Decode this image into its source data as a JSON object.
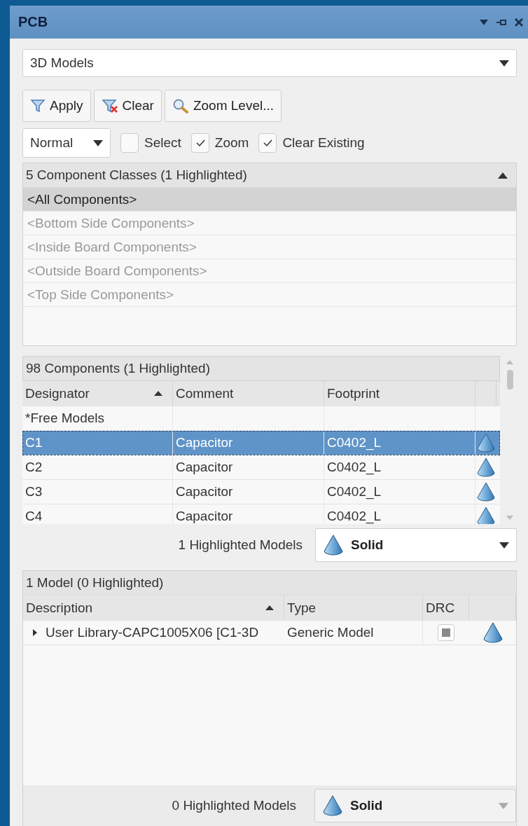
{
  "window": {
    "title": "PCB"
  },
  "mode_dropdown": {
    "value": "3D Models"
  },
  "buttons": [
    {
      "label": "Apply",
      "kind": "apply"
    },
    {
      "label": "Clear",
      "kind": "clear"
    },
    {
      "label": "Zoom Level...",
      "kind": "zoom"
    }
  ],
  "mask_dropdown": {
    "value": "Normal"
  },
  "options": [
    {
      "label": "Select",
      "checked": false
    },
    {
      "label": "Zoom",
      "checked": true
    },
    {
      "label": "Clear Existing",
      "checked": true
    }
  ],
  "classes": {
    "header": "5 Component Classes (1 Highlighted)",
    "expanded": true,
    "items": [
      {
        "label": "<All Components>",
        "selected": true
      },
      {
        "label": "<Bottom Side Components>",
        "selected": false
      },
      {
        "label": "<Inside Board Components>",
        "selected": false
      },
      {
        "label": "<Outside Board Components>",
        "selected": false
      },
      {
        "label": "<Top Side Components>",
        "selected": false
      }
    ]
  },
  "components": {
    "header": "98 Components (1 Highlighted)",
    "columns": [
      {
        "label": "Designator",
        "sorted": true
      },
      {
        "label": "Comment",
        "sorted": false
      },
      {
        "label": "Footprint",
        "sorted": false
      }
    ],
    "rows": [
      {
        "designator": "*Free Models",
        "comment": "",
        "footprint": "",
        "selected": false,
        "has_model": false
      },
      {
        "designator": "C1",
        "comment": "Capacitor",
        "footprint": "C0402_L",
        "selected": true,
        "has_model": true
      },
      {
        "designator": "C2",
        "comment": "Capacitor",
        "footprint": "C0402_L",
        "selected": false,
        "has_model": true
      },
      {
        "designator": "C3",
        "comment": "Capacitor",
        "footprint": "C0402_L",
        "selected": false,
        "has_model": true
      },
      {
        "designator": "C4",
        "comment": "Capacitor",
        "footprint": "C0402_L",
        "selected": false,
        "has_model": true
      }
    ],
    "footer": {
      "label": "1 Highlighted Models",
      "display": "Solid",
      "disabled": false
    }
  },
  "models": {
    "header": "1 Model (0 Highlighted)",
    "columns": [
      {
        "label": "Description",
        "sorted": true
      },
      {
        "label": "Type",
        "sorted": false
      },
      {
        "label": "DRC",
        "sorted": false
      }
    ],
    "rows": [
      {
        "description": "User Library-CAPC1005X06 [C1-3D",
        "type": "Generic Model",
        "expanded": false,
        "drc_indeterminate": true
      }
    ],
    "footer": {
      "label": "0 Highlighted Models",
      "display": "Solid",
      "disabled": true
    }
  }
}
